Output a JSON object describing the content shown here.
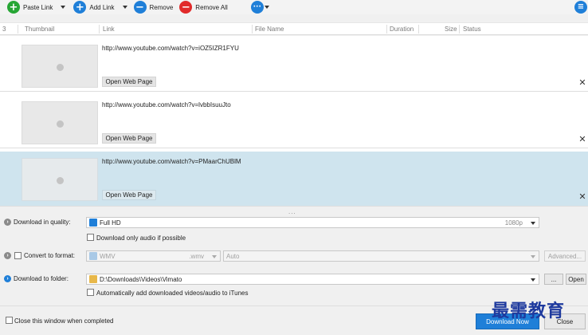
{
  "toolbar": {
    "paste_link": "Paste Link",
    "add_link": "Add Link",
    "remove": "Remove",
    "remove_all": "Remove All"
  },
  "header": {
    "count": "3",
    "thumbnail": "Thumbnail",
    "link": "Link",
    "file_name": "File Name",
    "duration": "Duration",
    "size": "Size",
    "status": "Status"
  },
  "rows": [
    {
      "link": "http://www.youtube.com/watch?v=iOZ5IZR1FYU",
      "open": "Open Web Page",
      "selected": false
    },
    {
      "link": "http://www.youtube.com/watch?v=lvbbIsuuJto",
      "open": "Open Web Page",
      "selected": false
    },
    {
      "link": "http://www.youtube.com/watch?v=PMaarChUBlM",
      "open": "Open Web Page",
      "selected": true
    }
  ],
  "splitter": "...",
  "options": {
    "quality_label": "Download in quality:",
    "quality_value": "Full HD",
    "quality_res": "1080p",
    "audio_only": "Download only audio if possible",
    "convert_label": "Convert to format:",
    "format_value": "WMV",
    "format_ext": ".wmv",
    "format_auto": "Auto",
    "advanced": "Advanced...",
    "folder_label": "Download to folder:",
    "folder_value": "D:\\Downloads\\Videos\\Vimato",
    "browse": "...",
    "open": "Open",
    "itunes": "Automatically add downloaded videos/audio to iTunes"
  },
  "footer": {
    "close_when_done": "Close this window when completed",
    "download": "Download Now",
    "cancel": "Close"
  },
  "watermark": "最需教育",
  "colors": {
    "accent": "#1f7fd8",
    "selected_row": "#cfe4ee",
    "add": "#27a635",
    "remove_all": "#e12a2a"
  }
}
